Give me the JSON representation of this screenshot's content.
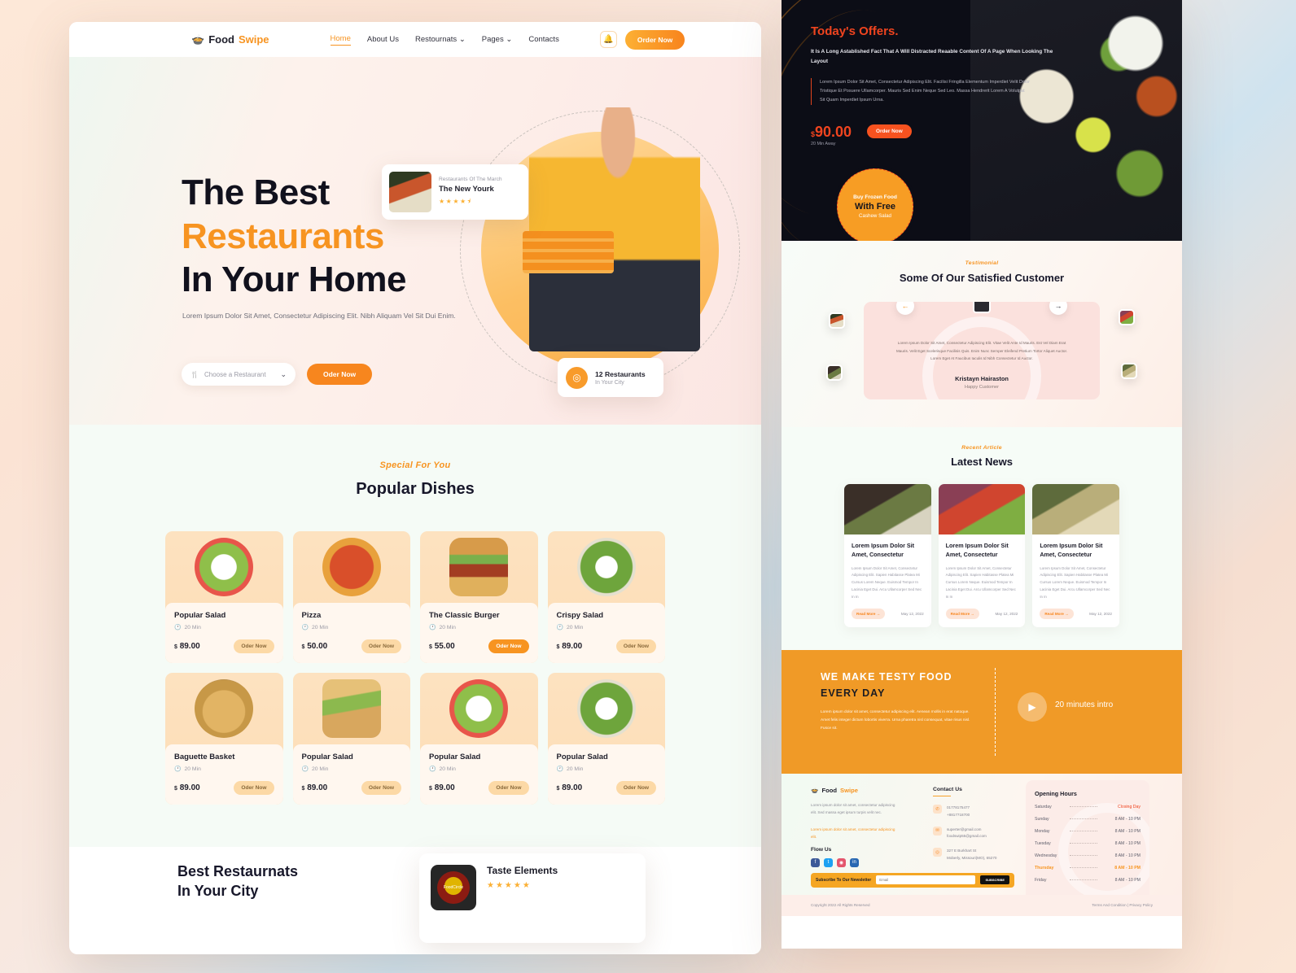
{
  "left": {
    "nav": {
      "logo_icon": "food-bowl-icon",
      "logo_first": "Food",
      "logo_second": "Swipe",
      "links": [
        {
          "label": "Home",
          "active": true
        },
        {
          "label": "About Us",
          "active": false
        },
        {
          "label": "Restournats ⌄",
          "active": false
        },
        {
          "label": "Pages ⌄",
          "active": false
        },
        {
          "label": "Contacts",
          "active": false
        }
      ],
      "bell_icon": "bell-icon",
      "order_button": "Order Now"
    },
    "hero": {
      "title_line1": "The Best",
      "title_line2": "Restaurants",
      "title_line3": "In Your Home",
      "subtitle": "Lorem Ipsum Dolor Sit Amet, Consectetur Adipiscing Elit. Nibh Aliquam Vel Sit Dui Enim.",
      "select_placeholder": "Choose a Restaurant",
      "select_icon": "cutlery-icon",
      "chevron_icon": "chevron-down-icon",
      "cta_button": "Oder Now",
      "rest_card": {
        "eyebrow": "Restaurants Of The March",
        "name": "The New Yourk",
        "stars": "★★★★⯨"
      },
      "loc_card": {
        "pin_icon": "location-pin-icon",
        "count": "12 Restaurants",
        "caption": "In Your City"
      }
    },
    "dishes": {
      "eyebrow": "Special For You",
      "title": "Popular Dishes",
      "clock_icon": "clock-icon",
      "items": [
        {
          "name": "Popular Salad",
          "time": "20 Min",
          "price": "89.00",
          "currency": "$",
          "cta": "Oder Now",
          "hot": false,
          "img": "ph-salad1"
        },
        {
          "name": "Pizza",
          "time": "20 Min",
          "price": "50.00",
          "currency": "$",
          "cta": "Oder Now",
          "hot": false,
          "img": "ph-pizza"
        },
        {
          "name": "The Classic Burger",
          "time": "20 Min",
          "price": "55.00",
          "currency": "$",
          "cta": "Oder Now",
          "hot": true,
          "img": "ph-burger"
        },
        {
          "name": "Crispy Salad",
          "time": "20 Min",
          "price": "89.00",
          "currency": "$",
          "cta": "Oder Now",
          "hot": false,
          "img": "ph-crisp"
        },
        {
          "name": "Baguette Basket",
          "time": "20 Min",
          "price": "89.00",
          "currency": "$",
          "cta": "Oder Now",
          "hot": false,
          "img": "ph-bread"
        },
        {
          "name": "Popular Salad",
          "time": "20 Min",
          "price": "89.00",
          "currency": "$",
          "cta": "Oder Now",
          "hot": false,
          "img": "ph-sand"
        },
        {
          "name": "Popular Salad",
          "time": "20 Min",
          "price": "89.00",
          "currency": "$",
          "cta": "Oder Now",
          "hot": false,
          "img": "ph-salad1"
        },
        {
          "name": "Popular Salad",
          "time": "20 Min",
          "price": "89.00",
          "currency": "$",
          "cta": "Oder Now",
          "hot": false,
          "img": "ph-crisp"
        }
      ]
    },
    "best": {
      "title_line1": "Best Restaurnats",
      "title_line2": "In Your City",
      "card": {
        "logo_text": "FoodCircle",
        "name": "Taste Elements",
        "stars": "★★★★★"
      }
    }
  },
  "right": {
    "offers": {
      "title_first": "Today's ",
      "title_second": "Offers.",
      "lead": "It Is A Long Astablished Fact That A Will Distracted Reaable Content Of A Page When Looking The Layout",
      "quote": "Lorem Ipsum Dolor Sit Amet, Consectetur Adipiscing Elit. Facilisi Fringilla Elementum Imperdiet Velit Dolor Tristique Et Posuere Ullamcorper. Mauris Sed Enim Neque Sed Leo. Massa Hendrerit Lorem A Volutpat Sit Quam Imperdiet Ipsum Urna.",
      "currency": "$",
      "price": "90.00",
      "order_button": "Order Now",
      "away": "20 Min Away",
      "away_icon": "clock-icon",
      "badge_line1": "Buy Frozen Food",
      "badge_line2": "With Free",
      "badge_line3": "Cashew Salad"
    },
    "testimonial": {
      "eyebrow": "Testimonial",
      "title": "Some Of Our Satisfied Customer",
      "prev_icon": "arrow-left-icon",
      "next_icon": "arrow-right-icon",
      "quote": "Lorem Ipsum Dolor Sit Amet, Consectetur Adipiscing Elit. Vitae Velit Ante Id Mauris. Est Vel Diam Erat Mauris. Velit Eget Scelerisque Facilisis Quis. Enim Nunc Semper Eleifend Pretium Tortor Aliquet Auctor. Lorem Eget At Faucibus Iaculis Id Nibh Consectetur Id Auctor.",
      "name": "Kristayn Hairaston",
      "role": "Happy Customer"
    },
    "news": {
      "eyebrow": "Recent Article",
      "title": "Latest News",
      "items": [
        {
          "title": "Lorem Ipsum Dolor Sit Amet, Consectetur",
          "excerpt": "Lorem Ipsum Dolor Sit Amet, Consectetur Adipiscing Elit. Sapien Habitasse Platea Mi Cursus Lorem Neque. Euismod Tempor In Lacinia Eget Dui. Arcu Ullamcorper Sed Nec In In",
          "cta": "Read More  →",
          "date": "May 12, 2022",
          "img": "ph-news1"
        },
        {
          "title": "Lorem Ipsum Dolor Sit Amet, Consectetur",
          "excerpt": "Lorem Ipsum Dolor Sit Amet, Consectetur Adipiscing Elit. Sapien Habitasse Platea Mi Cursus Lorem Neque. Euismod Tempor In Lacinia Eget Dui. Arcu Ullamcorper Sed Nec In In",
          "cta": "Read More  →",
          "date": "May 12, 2022",
          "img": "ph-news2"
        },
        {
          "title": "Lorem Ipsum Dolor Sit Amet, Consectetur",
          "excerpt": "Lorem Ipsum Dolor Sit Amet, Consectetur Adipiscing Elit. Sapien Habitasse Platea Mi Cursus Lorem Neque. Euismod Tempor In Lacinia Eget Dui. Arcu Ullamcorper Sed Nec In In",
          "cta": "Read More  →",
          "date": "May 12, 2022",
          "img": "ph-news3"
        }
      ]
    },
    "cta": {
      "line1": "WE MAKE TESTY FOOD",
      "line2": "EVERY DAY",
      "text": "Lorem ipsum dolor sit amet, consectetur adipiscing elit. Aenean mollis in erat natoque. Amet felis integer dictum lobortis viverra. Urna pharetra nisl consequat, vitae risus nisl. Fusce sit.",
      "play_icon": "play-icon",
      "intro_label": "20 minutes intro"
    },
    "footer": {
      "logo_first": "Food",
      "logo_second": "Swipe",
      "desc": "Lorem ipsum dolor sit amet, consectetur adipiscing elit. Sed massa eget ipsum turpis velit nec.",
      "desc_accent": "Lorem ipsum dolor sit amet, consectetur adipiscing elit.",
      "follow_title": "Flow Us",
      "socials": [
        "facebook-icon",
        "twitter-icon",
        "instagram-icon",
        "linkedin-icon"
      ],
      "newsletter_label": "Subscribe To Our Newsletter",
      "newsletter_placeholder": "Email",
      "newsletter_button": "SUBSCRIBE",
      "contact": {
        "title": "Contact Us",
        "phone_icon": "phone-icon",
        "phone1": "01778175477",
        "phone2": "+8817718700",
        "mail_icon": "mail-icon",
        "mail1": "superter@gmail.com",
        "mail2": "foodswip55@gmail.com",
        "pin_icon": "location-pin-icon",
        "addr1": "327 E Burkhart St",
        "addr2": "Moberly, Missouri(MO), 65270"
      },
      "hours": {
        "title": "Opening Hours",
        "rows": [
          {
            "day": "Saturday",
            "value": "Closing Day",
            "state": "closed"
          },
          {
            "day": "Sunday",
            "value": "8 AM - 10 PM",
            "state": "normal"
          },
          {
            "day": "Monday",
            "value": "8 AM - 10 PM",
            "state": "normal"
          },
          {
            "day": "Tuesday",
            "value": "8 AM - 10 PM",
            "state": "normal"
          },
          {
            "day": "Wednesday",
            "value": "8 AM - 10 PM",
            "state": "normal"
          },
          {
            "day": "Thursday",
            "value": "8 AM - 10 PM",
            "state": "highlight"
          },
          {
            "day": "Friday",
            "value": "8 AM - 10 PM",
            "state": "normal"
          }
        ]
      },
      "copyright": "Copyright 2022 All Rights Reserved",
      "legal": "Terms And Condition | Privacy Policy"
    }
  }
}
